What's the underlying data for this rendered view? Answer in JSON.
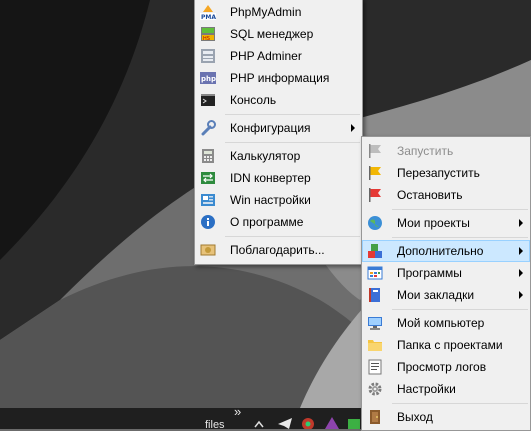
{
  "left_menu": {
    "items": [
      {
        "label": "PhpMyAdmin",
        "icon": "phpmyadmin-icon",
        "has_submenu": false
      },
      {
        "label": "SQL менеджер",
        "icon": "sql-manager-icon",
        "has_submenu": false
      },
      {
        "label": "PHP Adminer",
        "icon": "adminer-icon",
        "has_submenu": false
      },
      {
        "label": "PHP информация",
        "icon": "php-info-icon",
        "has_submenu": false
      },
      {
        "label": "Консоль",
        "icon": "console-icon",
        "has_submenu": false
      },
      {
        "label": "Конфигурация",
        "icon": "wrench-icon",
        "has_submenu": true
      },
      {
        "label": "Калькулятор",
        "icon": "calculator-icon",
        "has_submenu": false
      },
      {
        "label": "IDN конвертер",
        "icon": "idn-converter-icon",
        "has_submenu": false
      },
      {
        "label": "Win настройки",
        "icon": "win-settings-icon",
        "has_submenu": false
      },
      {
        "label": "О программе",
        "icon": "info-icon",
        "has_submenu": false
      },
      {
        "label": "Поблагодарить...",
        "icon": "thanks-icon",
        "has_submenu": false
      }
    ]
  },
  "tray_menu": {
    "items": [
      {
        "label": "Запустить",
        "icon": "flag-gray-icon",
        "disabled": true,
        "has_submenu": false
      },
      {
        "label": "Перезапустить",
        "icon": "flag-yellow-icon",
        "disabled": false,
        "has_submenu": false
      },
      {
        "label": "Остановить",
        "icon": "flag-red-icon",
        "disabled": false,
        "has_submenu": false
      },
      {
        "label": "Мои проекты",
        "icon": "globe-icon",
        "disabled": false,
        "has_submenu": true
      },
      {
        "label": "Дополнительно",
        "icon": "blocks-icon",
        "disabled": false,
        "has_submenu": true,
        "highlighted": true
      },
      {
        "label": "Программы",
        "icon": "programs-grid-icon",
        "disabled": false,
        "has_submenu": true
      },
      {
        "label": "Мои закладки",
        "icon": "bookmarks-icon",
        "disabled": false,
        "has_submenu": true
      },
      {
        "label": "Мой компьютер",
        "icon": "computer-icon",
        "disabled": false,
        "has_submenu": false
      },
      {
        "label": "Папка с проектами",
        "icon": "folder-icon",
        "disabled": false,
        "has_submenu": false
      },
      {
        "label": "Просмотр логов",
        "icon": "log-file-icon",
        "disabled": false,
        "has_submenu": false
      },
      {
        "label": "Настройки",
        "icon": "gear-icon",
        "disabled": false,
        "has_submenu": false
      },
      {
        "label": "Выход",
        "icon": "exit-door-icon",
        "disabled": false,
        "has_submenu": false
      }
    ]
  },
  "taskbar": {
    "overflow_label": "»",
    "files_label": "files"
  },
  "colors": {
    "menu_bg": "#f0f0f0",
    "highlight_bg": "#cce8ff",
    "taskbar_bg": "#1f1f1f"
  }
}
